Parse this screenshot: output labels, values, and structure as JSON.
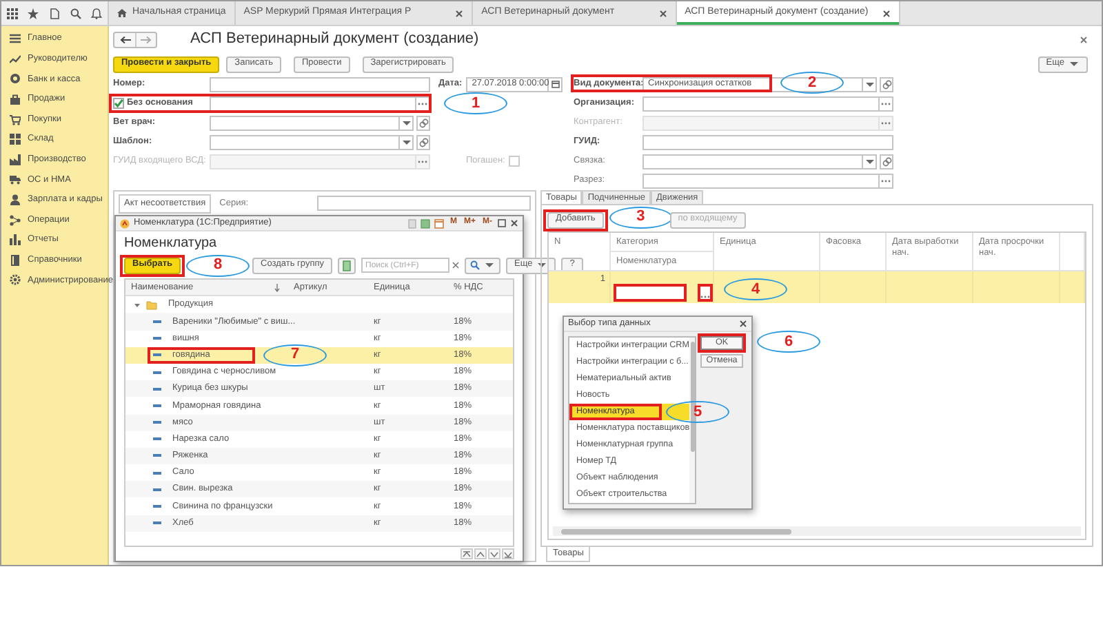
{
  "top_bar": {
    "tabs": [
      {
        "label": "Начальная страница",
        "kind": "home",
        "selected": false,
        "closable": false
      },
      {
        "label": "ASP Меркурий Прямая Интеграция Р",
        "kind": "page",
        "selected": false,
        "closable": true
      },
      {
        "label": "АСП Ветеринарный документ",
        "kind": "page",
        "selected": false,
        "closable": true
      },
      {
        "label": "АСП Ветеринарный документ (создание)",
        "kind": "page",
        "selected": true,
        "closable": true
      }
    ]
  },
  "sidebar": {
    "items": [
      {
        "label": "Главное"
      },
      {
        "label": "Руководителю"
      },
      {
        "label": "Банк и касса"
      },
      {
        "label": "Продажи"
      },
      {
        "label": "Покупки"
      },
      {
        "label": "Склад"
      },
      {
        "label": "Производство"
      },
      {
        "label": "ОС и НМА"
      },
      {
        "label": "Зарплата и кадры"
      },
      {
        "label": "Операции"
      },
      {
        "label": "Отчеты"
      },
      {
        "label": "Справочники"
      },
      {
        "label": "Администрирование"
      }
    ]
  },
  "document": {
    "title": "АСП Ветеринарный документ (создание)",
    "actions": [
      {
        "label": "Провести и закрыть",
        "default": true
      },
      {
        "label": "Записать",
        "default": false
      },
      {
        "label": "Провести",
        "default": false
      },
      {
        "label": "Зарегистрировать",
        "default": false
      }
    ],
    "more": "Еще",
    "left_fields": [
      {
        "label": "Номер:",
        "kind": "text",
        "required": true,
        "disabled": false
      },
      {
        "label": "Без основания",
        "kind": "checkbox",
        "checked": true,
        "required": true,
        "disabled": false,
        "annotation": {
          "number": "1"
        }
      },
      {
        "label": "Вет врач:",
        "kind": "select",
        "required": true,
        "disabled": false
      },
      {
        "label": "Шаблон:",
        "kind": "select",
        "required": true,
        "disabled": false
      },
      {
        "label": "ГУИД входящего ВСД:",
        "kind": "choice",
        "required": false,
        "disabled": true,
        "side_checkbox": {
          "label": "Погашен:",
          "checked": false,
          "disabled": true
        }
      }
    ],
    "date": {
      "label": "Дата:",
      "value": "27.07.2018  0:00:00"
    },
    "right_fields": [
      {
        "label": "Вид документа:",
        "kind": "select",
        "required": true,
        "disabled": false,
        "value": "Синхронизация остатков",
        "annotation": {
          "number": "2"
        }
      },
      {
        "label": "Организация:",
        "kind": "choice",
        "required": true,
        "disabled": false
      },
      {
        "label": "Контрагент:",
        "kind": "choice",
        "required": false,
        "disabled": true
      },
      {
        "label": "ГУИД:",
        "kind": "text",
        "required": true,
        "disabled": false
      },
      {
        "label": "Связка:",
        "kind": "select",
        "required": false,
        "disabled": false
      },
      {
        "label": "Разрез:",
        "kind": "choice",
        "required": false,
        "disabled": false
      }
    ]
  },
  "act_panel": {
    "tabs": [
      {
        "label": "Акт несоответствия",
        "selected": true
      }
    ],
    "series_label": "Серия:"
  },
  "nomenclature_window": {
    "title": "Номенклатура (1С:Предприятие)",
    "memory_buttons": [
      "M",
      "M+",
      "M-"
    ],
    "heading": "Номенклатура",
    "toolbar": {
      "select": {
        "label": "Выбрать",
        "annotation": {
          "number": "8"
        }
      },
      "create_group": "Создать группу",
      "search_placeholder": "Поиск (Ctrl+F)",
      "more": "Еще",
      "help": "?"
    },
    "columns": [
      "Наименование",
      "Артикул",
      "Единица",
      "% НДС"
    ],
    "tree": [
      {
        "name": "Продукция",
        "kind": "group",
        "expanded": true,
        "selected": false,
        "children": [
          {
            "name": "Вареники \"Любимые\" с виш...",
            "kind": "item",
            "unit": "кг",
            "vat": "18%",
            "selected": false
          },
          {
            "name": "вишня",
            "kind": "item",
            "unit": "кг",
            "vat": "18%",
            "selected": false
          },
          {
            "name": "говядина",
            "kind": "item",
            "unit": "кг",
            "vat": "18%",
            "selected": true,
            "annotation": {
              "number": "7"
            }
          },
          {
            "name": "Говядина с черносливом",
            "kind": "item",
            "unit": "кг",
            "vat": "18%",
            "selected": false
          },
          {
            "name": "Курица без шкуры",
            "kind": "item",
            "unit": "шт",
            "vat": "18%",
            "selected": false
          },
          {
            "name": "Мраморная говядина",
            "kind": "item",
            "unit": "кг",
            "vat": "18%",
            "selected": false
          },
          {
            "name": "мясо",
            "kind": "item",
            "unit": "шт",
            "vat": "18%",
            "selected": false
          },
          {
            "name": "Нарезка сало",
            "kind": "item",
            "unit": "кг",
            "vat": "18%",
            "selected": false
          },
          {
            "name": "Ряженка",
            "kind": "item",
            "unit": "кг",
            "vat": "18%",
            "selected": false
          },
          {
            "name": "Сало",
            "kind": "item",
            "unit": "кг",
            "vat": "18%",
            "selected": false
          },
          {
            "name": "Свин. вырезка",
            "kind": "item",
            "unit": "кг",
            "vat": "18%",
            "selected": false
          },
          {
            "name": "Свинина по французски",
            "kind": "item",
            "unit": "кг",
            "vat": "18%",
            "selected": false
          },
          {
            "name": "Хлеб",
            "kind": "item",
            "unit": "кг",
            "vat": "18%",
            "selected": false
          }
        ]
      }
    ]
  },
  "goods_panel": {
    "tabs": [
      {
        "label": "Товары",
        "selected": true
      },
      {
        "label": "Подчиненные",
        "selected": false
      },
      {
        "label": "Движения",
        "selected": false
      }
    ],
    "toolbar": [
      {
        "label": "Добавить",
        "disabled": false,
        "annotation": {
          "number": "3"
        }
      },
      {
        "label": "по входящему",
        "disabled": true
      }
    ],
    "columns": [
      {
        "label": "N"
      },
      {
        "label": "Категория",
        "sub_label": "Номенклатура"
      },
      {
        "label": "Единица"
      },
      {
        "label": "Фасовка"
      },
      {
        "label": "Дата выработки нач."
      },
      {
        "label": "Дата просрочки нач."
      }
    ],
    "rows": [
      {
        "n": "1",
        "selected": true,
        "editing": true,
        "annotation": {
          "number": "4"
        }
      }
    ],
    "bottom_tabs": [
      {
        "label": "Товары",
        "selected": true
      }
    ]
  },
  "type_dialog": {
    "title": "Выбор типа данных",
    "items": [
      {
        "label": "Настройки интеграции CRM",
        "selected": false
      },
      {
        "label": "Настройки интеграции с б...",
        "selected": false
      },
      {
        "label": "Нематериальный актив",
        "selected": false
      },
      {
        "label": "Новость",
        "selected": false
      },
      {
        "label": "Номенклатура",
        "selected": true,
        "annotation": {
          "number": "5"
        }
      },
      {
        "label": "Номенклатура поставщиков",
        "selected": false
      },
      {
        "label": "Номенклатурная группа",
        "selected": false
      },
      {
        "label": "Номер ТД",
        "selected": false
      },
      {
        "label": "Объект наблюдения",
        "selected": false
      },
      {
        "label": "Объект строительства",
        "selected": false
      }
    ],
    "buttons": [
      {
        "label": "OK",
        "default": true,
        "annotation": {
          "number": "6"
        }
      },
      {
        "label": "Отмена",
        "default": false
      }
    ]
  }
}
